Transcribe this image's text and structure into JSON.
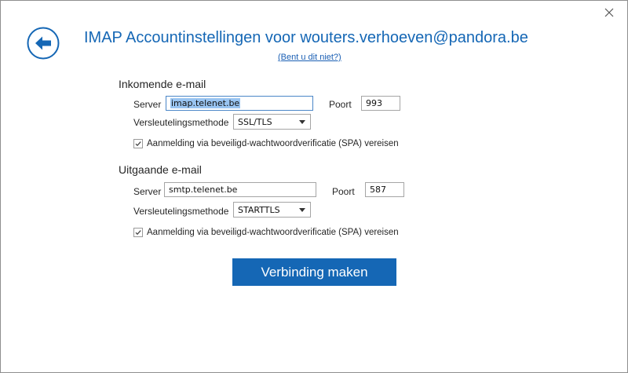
{
  "dialog": {
    "title": "IMAP Accountinstellingen voor wouters.verhoeven@pandora.be",
    "not_you_link": "(Bent u dit niet?)"
  },
  "incoming": {
    "section_title": "Inkomende e-mail",
    "server_label": "Server",
    "server_value": "imap.telenet.be",
    "port_label": "Poort",
    "port_value": "993",
    "encryption_label": "Versleutelingsmethode",
    "encryption_value": "SSL/TLS",
    "spa_label": "Aanmelding via beveiligd-wachtwoordverificatie (SPA) vereisen",
    "spa_checked": true
  },
  "outgoing": {
    "section_title": "Uitgaande e-mail",
    "server_label": "Server",
    "server_value": "smtp.telenet.be",
    "port_label": "Poort",
    "port_value": "587",
    "encryption_label": "Versleutelingsmethode",
    "encryption_value": "STARTTLS",
    "spa_label": "Aanmelding via beveiligd-wachtwoordverificatie (SPA) vereisen",
    "spa_checked": true
  },
  "actions": {
    "connect_label": "Verbinding maken"
  },
  "icons": {
    "back": "back-arrow-circle-icon",
    "close": "close-icon",
    "check": "checkmark-icon"
  },
  "colors": {
    "accent": "#1567b5",
    "selection": "#99c4f1"
  }
}
